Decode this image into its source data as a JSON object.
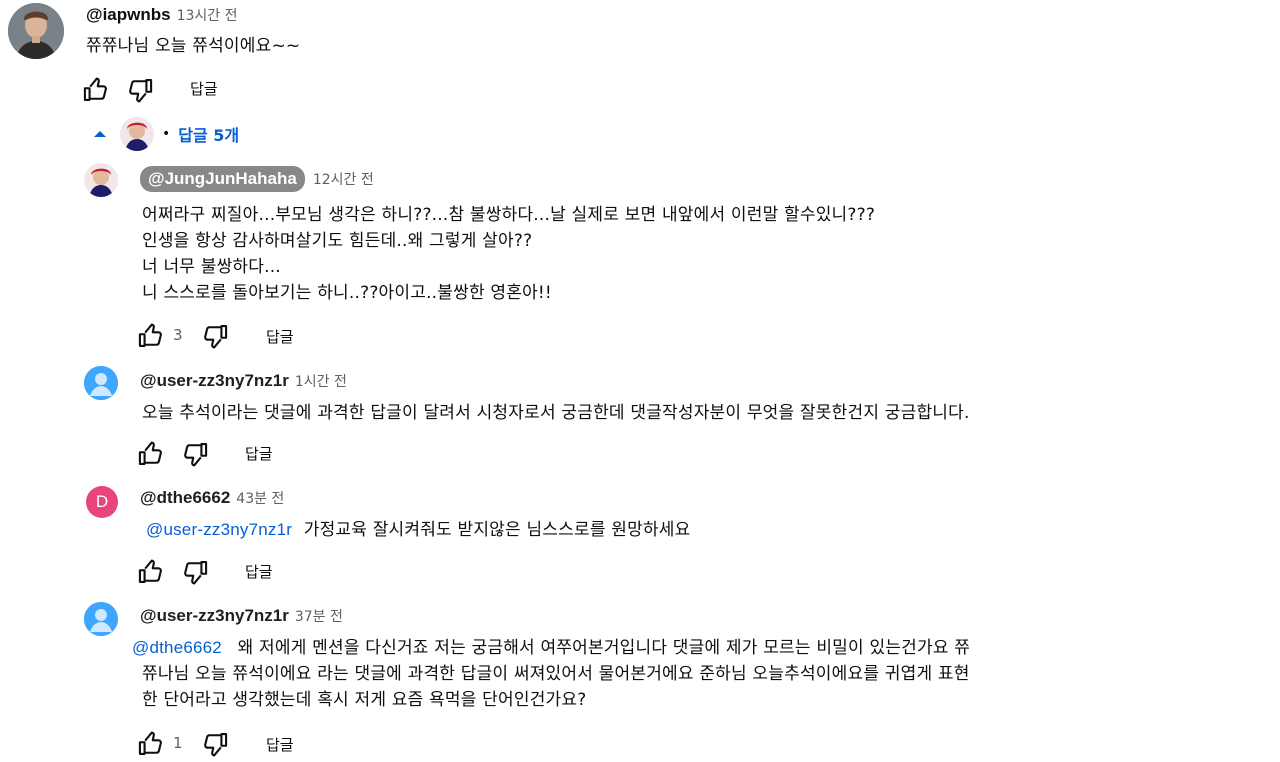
{
  "comment": {
    "handle": "@iapwnbs",
    "time": "13시간 전",
    "text": "쮸쮸나님 오늘 쮸석이에요~~",
    "reply_label": "답글"
  },
  "replies_toggle": {
    "dot": "•",
    "label": "답글 5개"
  },
  "replies": [
    {
      "handle": "@JungJunHahaha",
      "time": "12시간 전",
      "lines": [
        "어쩌라구 찌질아...부모님 생각은 하니??...참 불쌍하다...날 실제로 보면 내앞에서 이런말 할수있니???",
        "인생을 항상 감사하며살기도 힘든데..왜 그렇게 살아??",
        "너 너무 불쌍하다...",
        "니 스스로를 돌아보기는 하니..??아이고..불쌍한 영혼아!!"
      ],
      "likes": "3",
      "reply_label": "답글"
    },
    {
      "handle": "@user-zz3ny7nz1r",
      "time": "1시간 전",
      "lines": [
        "오늘 추석이라는 댓글에 과격한 답글이 달려서 시청자로서 궁금한데 댓글작성자분이 무엇을 잘못한건지 궁금합니다."
      ],
      "reply_label": "답글"
    },
    {
      "avatar_letter": "D",
      "handle": "@dthe6662",
      "time": "43분 전",
      "mention": "@user-zz3ny7nz1r",
      "text": "가정교육 잘시켜줘도 받지않은 님스스로를 원망하세요",
      "reply_label": "답글"
    },
    {
      "handle": "@user-zz3ny7nz1r",
      "time": "37분 전",
      "mention": "@dthe6662",
      "line1": "왜 저에게 멘션을 다신거죠 저는 궁금해서 여쭈어본거입니다 댓글에 제가 모르는 비밀이 있는건가요 쮸",
      "line2": "쮸나님 오늘 쮸석이에요 라는 댓글에 과격한 답글이 써져있어서 물어본거에요 준하님 오늘추석이에요를 귀엽게 표현",
      "line3": "한 단어라고 생각했는데 혹시 저게 요즘 욕먹을 단어인건가요?",
      "likes": "1",
      "reply_label": "답글"
    }
  ],
  "colors": {
    "link": "#065fd4",
    "letter_avatar": "#e8457c",
    "default_avatar": "#3ea6ff"
  }
}
